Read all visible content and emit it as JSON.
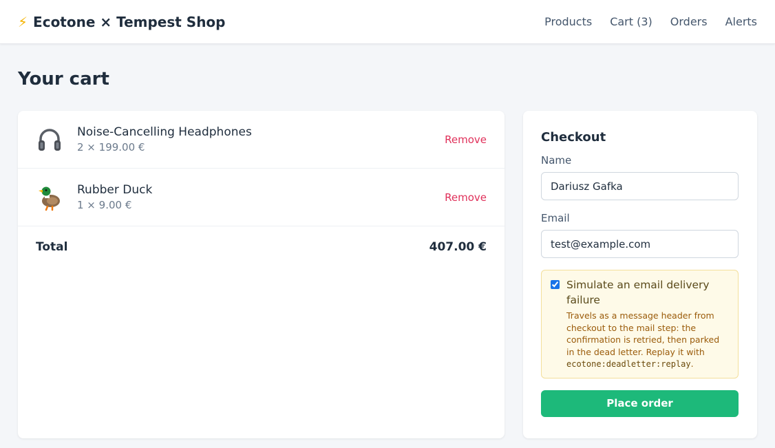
{
  "header": {
    "brand_icon": "⚡",
    "brand_name": "Ecotone × Tempest Shop",
    "nav": {
      "products": "Products",
      "cart": "Cart (3)",
      "orders": "Orders",
      "alerts": "Alerts"
    }
  },
  "page": {
    "title": "Your cart"
  },
  "cart": {
    "items": [
      {
        "icon": "headphones-icon",
        "name": "Noise-Cancelling Headphones",
        "meta": "2 × 199.00 €",
        "remove_label": "Remove"
      },
      {
        "icon": "duck-icon",
        "name": "Rubber Duck",
        "meta": "1 × 9.00 €",
        "remove_label": "Remove"
      }
    ],
    "total_label": "Total",
    "total_value": "407.00 €"
  },
  "checkout": {
    "title": "Checkout",
    "name_label": "Name",
    "name_value": "Dariusz Gafka",
    "email_label": "Email",
    "email_value": "test@example.com",
    "failure_checkbox_checked": true,
    "failure_title": "Simulate an email delivery failure",
    "failure_text_before": "Travels as a message header from checkout to the mail step: the confirmation is retried, then parked in the dead letter. Replay it with ",
    "failure_code": "ecotone:deadletter:replay",
    "failure_text_after": ".",
    "place_order_label": "Place order"
  },
  "colors": {
    "accent_green": "#1db97a",
    "remove_red": "#e0305a",
    "warning_bg": "#fefae8"
  }
}
